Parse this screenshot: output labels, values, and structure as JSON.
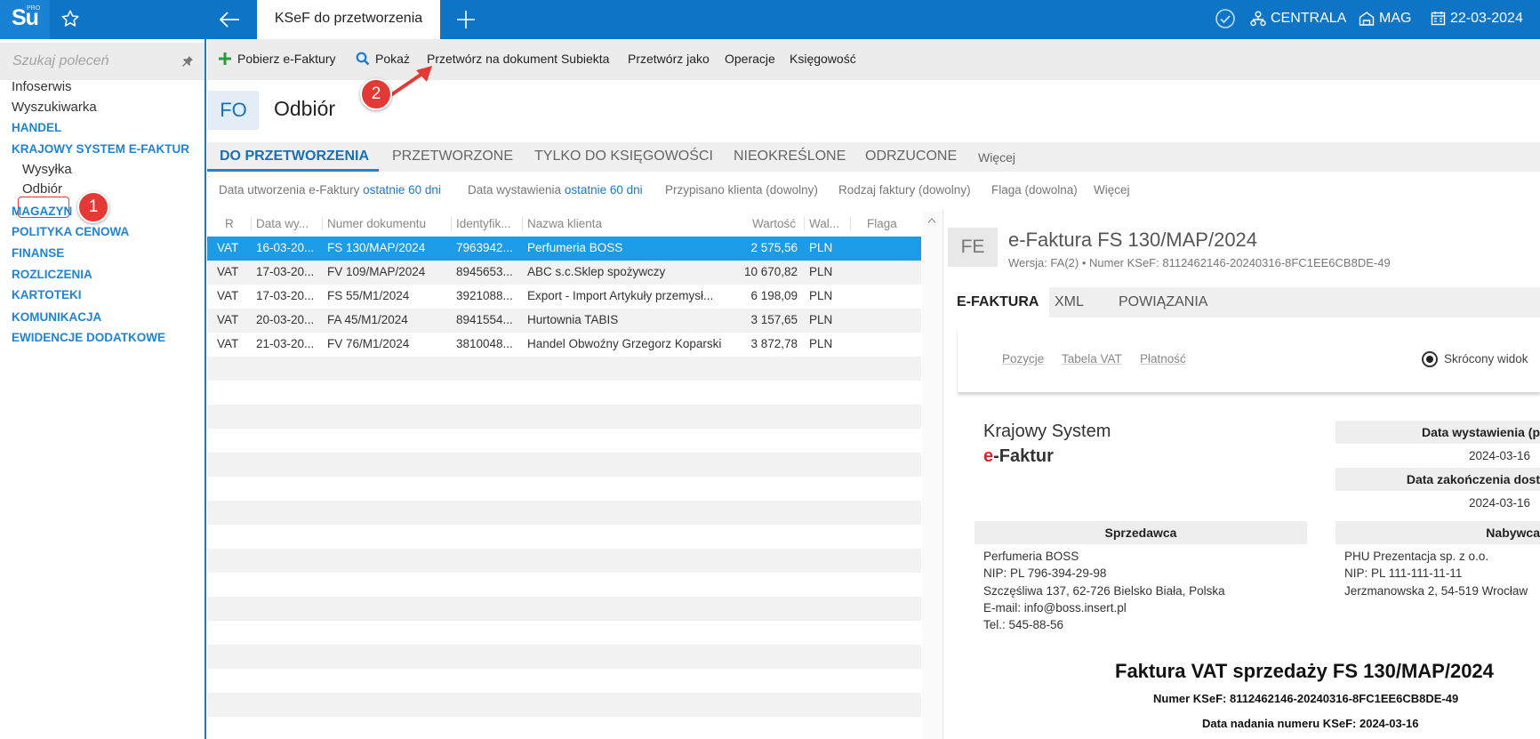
{
  "topbar": {
    "logo": "Su",
    "logo_badge": "PRO",
    "active_tab": "KSeF do przetworzenia",
    "branch": "CENTRALA",
    "warehouse": "MAG",
    "date": "22-03-2024"
  },
  "sidebar": {
    "search_placeholder": "Szukaj poleceń",
    "links": [
      "Infoserwis",
      "Wyszukiwarka"
    ],
    "sections": {
      "handel": "HANDEL",
      "ksef": "KRAJOWY SYSTEM E-FAKTUR",
      "ksef_items": [
        "Wysyłka",
        "Odbiór"
      ],
      "rest": [
        "MAGAZYN",
        "POLITYKA CENOWA",
        "FINANSE",
        "ROZLICZENIA",
        "KARTOTEKI",
        "KOMUNIKACJA",
        "EWIDENCJE DODATKOWE"
      ]
    }
  },
  "annotations": {
    "step1": "1",
    "step2": "2"
  },
  "toolbar": {
    "download": "Pobierz e-Faktury",
    "show": "Pokaż",
    "process": "Przetwórz na dokument Subiekta",
    "process_as": "Przetwórz jako",
    "operations": "Operacje",
    "accounting": "Księgowość"
  },
  "module": {
    "code": "FO",
    "title": "Odbiór"
  },
  "tabs": {
    "items": [
      "DO PRZETWORZENIA",
      "PRZETWORZONE",
      "TYLKO DO KSIĘGOWOŚCI",
      "NIEOKREŚLONE",
      "ODRZUCONE"
    ],
    "more": "Więcej"
  },
  "filters": {
    "created_label": "Data utworzenia e-Faktury",
    "created_value": "ostatnie 60 dni",
    "issued_label": "Data wystawienia",
    "issued_value": "ostatnie 60 dni",
    "client": "Przypisano klienta (dowolny)",
    "type": "Rodzaj faktury (dowolny)",
    "flag": "Flaga (dowolna)",
    "more": "Więcej"
  },
  "grid": {
    "columns": [
      "R",
      "Data wy...",
      "Numer dokumentu",
      "Identyfik...",
      "Nazwa klienta",
      "Wartość",
      "Wal...",
      "Flaga"
    ],
    "rows": [
      [
        "VAT",
        "16-03-20...",
        "FS 130/MAP/2024",
        "7963942...",
        "Perfumeria BOSS",
        "2 575,56",
        "PLN",
        ""
      ],
      [
        "VAT",
        "17-03-20...",
        "FV 109/MAP/2024",
        "8945653...",
        "ABC s.c.Sklep spożywczy",
        "10 670,82",
        "PLN",
        ""
      ],
      [
        "VAT",
        "17-03-20...",
        "FS 55/M1/2024",
        "3921088...",
        "Export - Import Artykuły przemysł...",
        "6 198,09",
        "PLN",
        ""
      ],
      [
        "VAT",
        "20-03-20...",
        "FA 45/M1/2024",
        "8941554...",
        "Hurtownia TABIS",
        "3 157,65",
        "PLN",
        ""
      ],
      [
        "VAT",
        "21-03-20...",
        "FV 76/M1/2024",
        "3810048...",
        "Handel Obwoźny Grzegorz Koparski",
        "3 872,78",
        "PLN",
        ""
      ]
    ]
  },
  "preview": {
    "badge": "FE",
    "title": "e-Faktura FS 130/MAP/2024",
    "subtitle": "Wersja: FA(2) • Numer KSeF: 8112462146-20240316-8FC1EE6CB8DE-49",
    "tabs": [
      "E-FAKTURA",
      "XML",
      "POWIĄZANIA"
    ],
    "nav": [
      "Pozycje",
      "Tabela VAT",
      "Płatność"
    ],
    "short_view": "Skrócony widok",
    "ksef_line1": "Krajowy System",
    "ksef_e": "e",
    "ksef_line2": "-Faktur",
    "issue_date_label": "Data wystawienia (p",
    "issue_date": "2024-03-16",
    "end_date_label": "Data zakończenia dost",
    "end_date": "2024-03-16",
    "seller_header": "Sprzedawca",
    "seller": [
      "Perfumeria BOSS",
      "NIP: PL 796-394-29-98",
      "Szczęśliwa 137, 62-726 Bielsko Biała, Polska",
      "E-mail: info@boss.insert.pl",
      "Tel.: 545-88-56"
    ],
    "buyer_header": "Nabywca",
    "buyer": [
      "PHU Prezentacja sp. z o.o.",
      "NIP: PL 111-111-11-11",
      "Jerzmanowska 2, 54-519 Wrocław"
    ],
    "invoice_title": "Faktura VAT sprzedaży FS 130/MAP/2024",
    "ksef_number": "Numer KSeF: 8112462146-20240316-8FC1EE6CB8DE-49",
    "ksef_date": "Data nadania numeru KSeF: 2024-03-16"
  },
  "colors": {
    "brand_blue": "#0d74c6",
    "link_blue": "#1f84d6",
    "selected_row": "#1c9be6",
    "annotation_red": "#e53935"
  }
}
